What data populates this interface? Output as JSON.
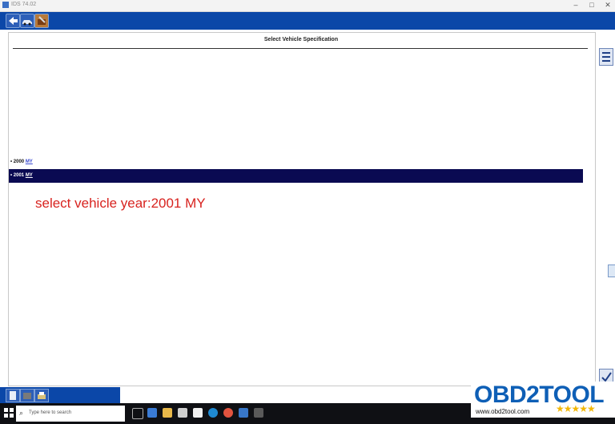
{
  "window": {
    "title": "IDS 74.02",
    "minimize_icon": "minimize-icon",
    "maximize_icon": "maximize-icon",
    "close_icon": "close-icon"
  },
  "toolbar": {
    "icons": [
      "back-arrow-icon",
      "vehicle-icon",
      "toolbox-icon"
    ]
  },
  "page": {
    "heading": "Select Vehicle Specification",
    "options": [
      {
        "year": "2000",
        "suffix": "MY",
        "selected": false
      },
      {
        "year": "2001",
        "suffix": "MY",
        "selected": true
      }
    ],
    "annotation": "select vehicle year:2001 MY"
  },
  "taskbar": {
    "search_placeholder": "Type here to search"
  },
  "watermark": {
    "brand": "OBD2TOOL",
    "url": "www.obd2tool.com",
    "stars": "★★★★★"
  },
  "colors": {
    "toolbar": "#0b47a8",
    "selected_row": "#0a0a52",
    "annotation": "#d8231f",
    "brand": "#0e5fb6"
  }
}
